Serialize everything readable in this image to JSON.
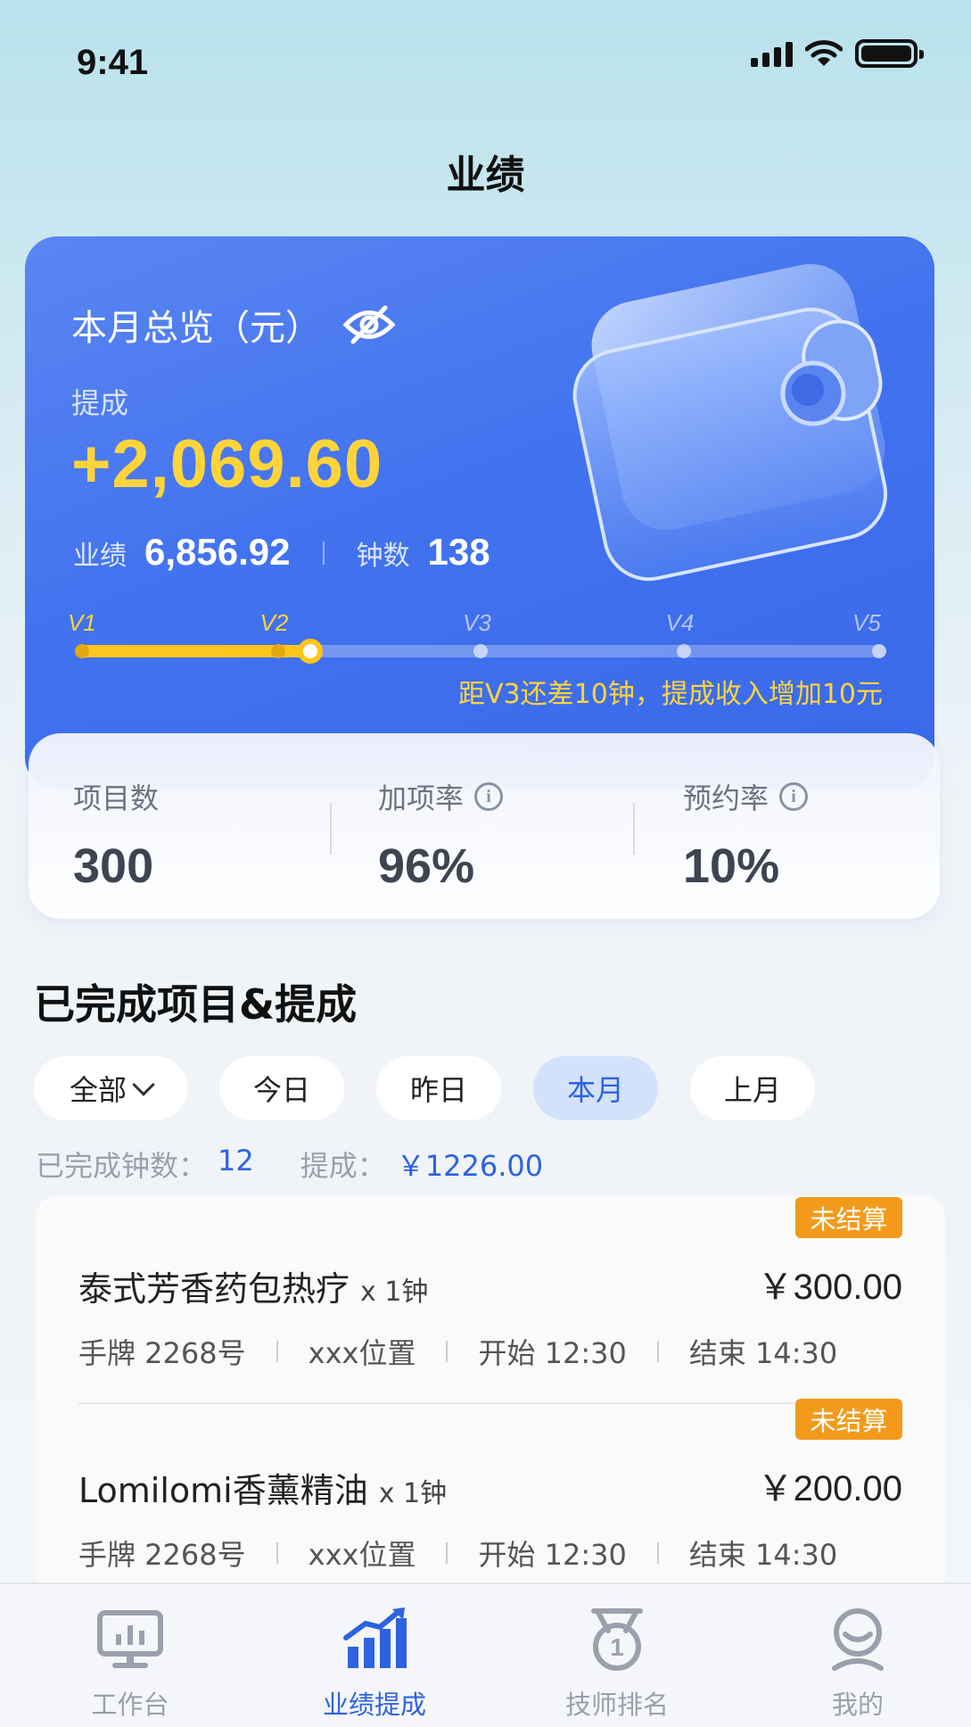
{
  "status_bar": {
    "time": "9:41"
  },
  "page": {
    "title": "业绩"
  },
  "overview": {
    "title": "本月总览（元）",
    "commission_label": "提成",
    "commission_value": "+2,069.60",
    "performance_label": "业绩",
    "performance_value": "6,856.92",
    "minutes_label": "钟数",
    "minutes_value": "138",
    "levels": [
      "V1",
      "V2",
      "V3",
      "V4",
      "V5"
    ],
    "current_level": "V2",
    "progress_fraction": 0.29,
    "hint": "距V3还差10钟，提成收入增加10元"
  },
  "stats": [
    {
      "label": "项目数",
      "value": "300"
    },
    {
      "label": "加项率",
      "value": "96%"
    },
    {
      "label": "预约率",
      "value": "10%"
    }
  ],
  "section": {
    "title": "已完成项目&提成",
    "filters": [
      "全部",
      "今日",
      "昨日",
      "本月",
      "上月"
    ],
    "active_filter": "本月",
    "summary_minutes_label": "已完成钟数：",
    "summary_minutes_value": "12",
    "summary_commission_label": "提成：",
    "summary_commission_value": "￥1226.00"
  },
  "orders": [
    {
      "badge": "未结算",
      "name": "泰式芳香药包热疗",
      "qty": "x 1钟",
      "price": "￥300.00",
      "tag": "手牌 2268号",
      "location": "xxx位置",
      "start": "开始 12:30",
      "end": "结束 14:30"
    },
    {
      "badge": "未结算",
      "name": "Lomilomi香薰精油",
      "qty": "x 1钟",
      "price": "￥200.00",
      "tag": "手牌 2268号",
      "location": "xxx位置",
      "start": "开始 12:30",
      "end": "结束 14:30"
    }
  ],
  "tabbar": {
    "items": [
      {
        "label": "工作台",
        "icon": "monitor-chart-icon"
      },
      {
        "label": "业绩提成",
        "icon": "bar-chart-trend-icon"
      },
      {
        "label": "技师排名",
        "icon": "medal-icon"
      },
      {
        "label": "我的",
        "icon": "user-profile-icon"
      }
    ],
    "active": "业绩提成"
  },
  "colors": {
    "card_blue": "#4273ef",
    "accent_yellow": "#ffd43a",
    "active_blue": "#2e62e0",
    "badge_orange": "#f39a1a"
  }
}
